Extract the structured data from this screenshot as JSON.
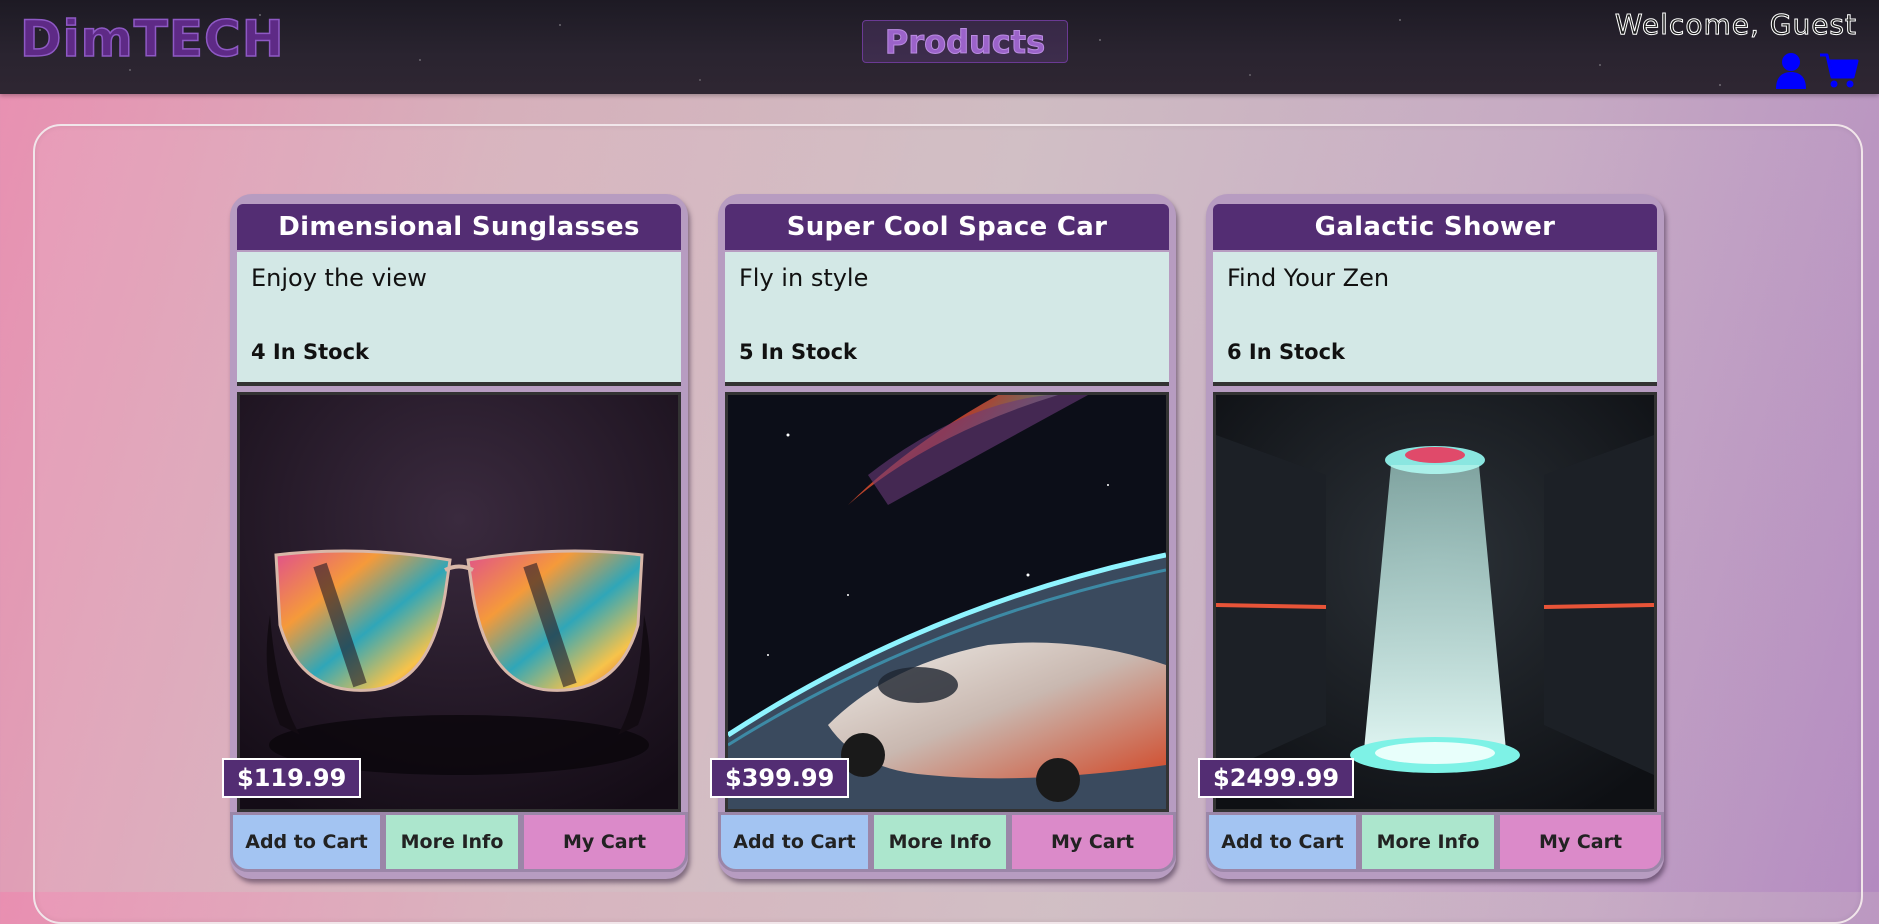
{
  "header": {
    "logo": "DimTECH",
    "nav_products": "Products",
    "welcome": "Welcome, Guest",
    "icons": [
      "user-icon",
      "cart-icon"
    ],
    "icon_color": "#0000ff"
  },
  "products": [
    {
      "title": "Dimensional Sunglasses",
      "tagline": "Enjoy the view",
      "stock": "4 In Stock",
      "price": "$119.99",
      "image": "sunglasses-image",
      "buttons": {
        "add": "Add to Cart",
        "info": "More Info",
        "cart": "My Cart"
      }
    },
    {
      "title": "Super Cool Space Car",
      "tagline": "Fly in style",
      "stock": "5 In Stock",
      "price": "$399.99",
      "image": "space-car-image",
      "buttons": {
        "add": "Add to Cart",
        "info": "More Info",
        "cart": "My Cart"
      }
    },
    {
      "title": "Galactic Shower",
      "tagline": "Find Your Zen",
      "stock": "6 In Stock",
      "price": "$2499.99",
      "image": "galactic-shower-image",
      "buttons": {
        "add": "Add to Cart",
        "info": "More Info",
        "cart": "My Cart"
      }
    }
  ],
  "colors": {
    "card_header": "#532d73",
    "card_body": "#d3e8e6",
    "add_button": "#a3c4f2",
    "info_button": "#ace6cd",
    "cart_button": "#db8ac9"
  }
}
